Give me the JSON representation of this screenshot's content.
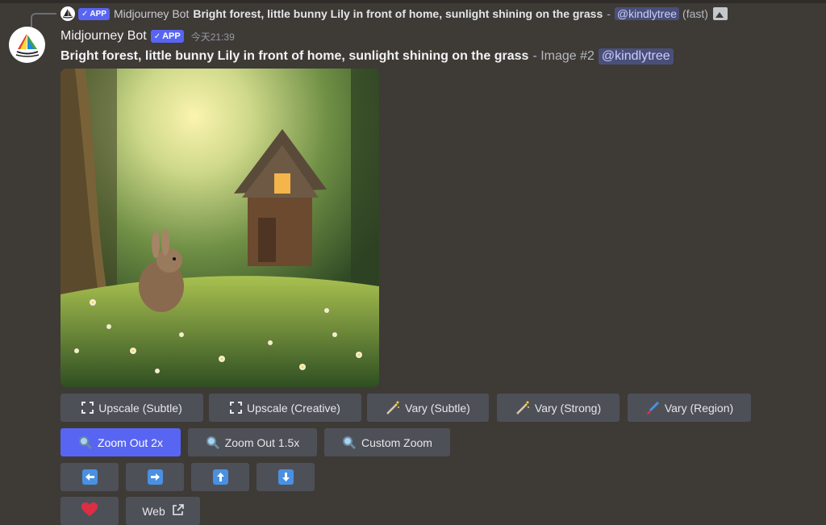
{
  "reply": {
    "bot_name": "Midjourney Bot",
    "app_tag": "APP",
    "prompt": "Bright forest, little bunny Lily in front of home, sunlight shining on the grass",
    "separator": "-",
    "mention": "@kindlytree",
    "speed": "(fast)",
    "icon": "image-icon"
  },
  "message": {
    "bot_name": "Midjourney Bot",
    "app_tag": "APP",
    "timestamp": "今天21:39",
    "prompt": "Bright forest, little bunny Lily in front of home, sunlight shining on the grass",
    "image_label": "- Image #2",
    "mention": "@kindlytree"
  },
  "buttons": {
    "row1": [
      {
        "label": "Upscale (Subtle)",
        "icon": "expand-arrows-icon"
      },
      {
        "label": "Upscale (Creative)",
        "icon": "expand-arrows-icon"
      },
      {
        "label": "Vary (Subtle)",
        "icon": "magic-wand-icon"
      },
      {
        "label": "Vary (Strong)",
        "icon": "magic-wand-icon"
      },
      {
        "label": "Vary (Region)",
        "icon": "paintbrush-icon"
      }
    ],
    "row2": [
      {
        "label": "Zoom Out 2x",
        "icon": "magnifier-icon",
        "active": true
      },
      {
        "label": "Zoom Out 1.5x",
        "icon": "magnifier-icon"
      },
      {
        "label": "Custom Zoom",
        "icon": "magnifier-icon"
      }
    ],
    "row3": [
      {
        "icon": "arrow-left-icon"
      },
      {
        "icon": "arrow-right-icon"
      },
      {
        "icon": "arrow-up-icon"
      },
      {
        "icon": "arrow-down-icon"
      }
    ],
    "row4": [
      {
        "icon": "heart-icon"
      },
      {
        "label": "Web",
        "icon": "external-link-icon"
      }
    ]
  },
  "colors": {
    "background": "#3e3a36",
    "button": "#4e5058",
    "primary": "#5865f2",
    "mention_bg": "#4a4f7a",
    "mention_text": "#c9cdfb",
    "arrow_blue": "#4a90e2",
    "heart": "#dd2e44"
  }
}
